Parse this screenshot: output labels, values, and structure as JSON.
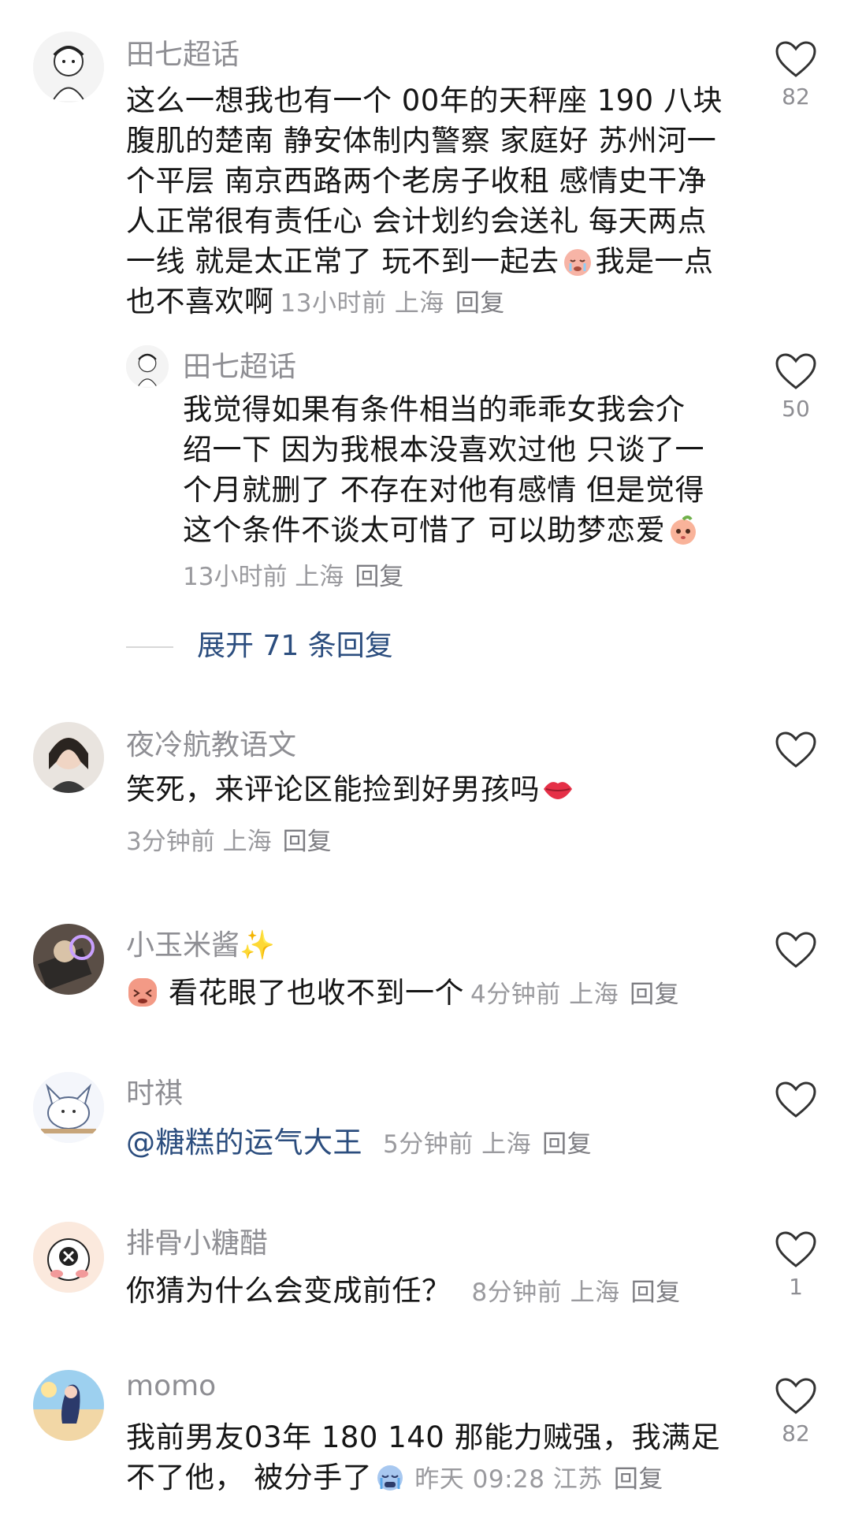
{
  "comments": [
    {
      "username": "田七超话",
      "lines": [
        "这么一想我也有一个 00年的天秤座 190 八块",
        "腹肌的楚南 静安体制内警察 家庭好 苏州河一",
        "个平层 南京西路两个老房子收租 感情史干净",
        "人正常很有责任心 会计划约会送礼  每天两点",
        "一线 就是太正常了 玩不到一起去",
        "我是一点",
        "也不喜欢啊"
      ],
      "meta": "13小时前 上海",
      "reply": "回复",
      "likes": "82"
    },
    {
      "username": "田七超话",
      "lines": [
        "我觉得如果有条件相当的乖乖女我会介",
        "绍一下 因为我根本没喜欢过他 只谈了一",
        "个月就删了 不存在对他有感情  但是觉得",
        "这个条件不谈太可惜了 可以助梦恋爱"
      ],
      "meta": "13小时前 上海",
      "reply": "回复",
      "likes": "50"
    },
    {
      "username": "夜冷航教语文",
      "text": "笑死，来评论区能捡到好男孩吗",
      "meta": "3分钟前 上海",
      "reply": "回复",
      "likes": ""
    },
    {
      "username": "小玉米酱",
      "username_suffix": "✨",
      "text": "看花眼了也收不到一个",
      "meta": "4分钟前 上海",
      "reply": "回复",
      "likes": ""
    },
    {
      "username": "时祺",
      "text": "@糖糕的运气大王",
      "meta": "5分钟前 上海",
      "reply": "回复",
      "likes": ""
    },
    {
      "username": "排骨小糖醋",
      "text": "你猜为什么会变成前任？",
      "meta": "8分钟前 上海",
      "reply": "回复",
      "likes": "1"
    },
    {
      "username": "momo",
      "lines": [
        "我前男友03年 180 140 那能力贼强，我满足",
        "不了他，  被分手了"
      ],
      "meta": "昨天 09:28 江苏",
      "reply": "回复",
      "likes": "82"
    }
  ],
  "expand_label": "展开 71 条回复",
  "colors": {
    "link": "#2b4d7e",
    "meta": "#9a9a9e",
    "username": "#8e8e93"
  },
  "icons": [
    "heart-outline-icon",
    "crying-emoji-icon",
    "peach-emoji-icon",
    "lips-emoji-icon",
    "dizzy-emoji-icon",
    "sparkles-icon"
  ]
}
